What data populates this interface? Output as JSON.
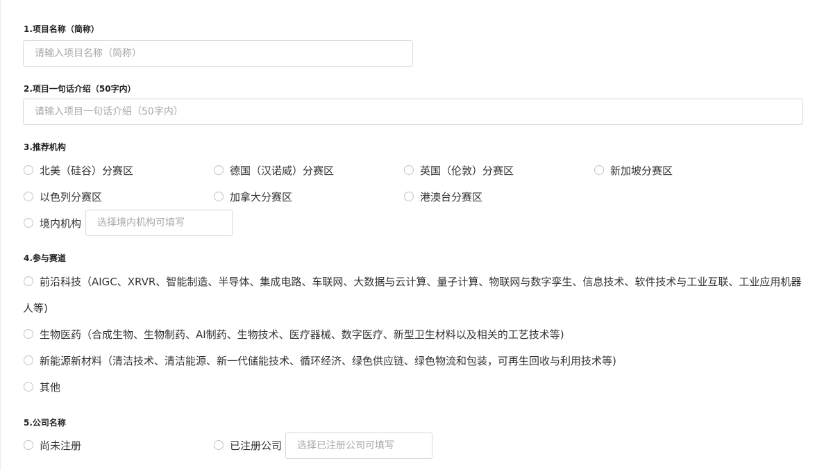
{
  "q1": {
    "label": "1.项目名称（简称）",
    "placeholder": "请输入项目名称（简称）"
  },
  "q2": {
    "label": "2.项目一句话介绍（50字内）",
    "placeholder": "请输入项目一句话介绍（50字内）"
  },
  "q3": {
    "label": "3.推荐机构",
    "options": [
      "北美（硅谷）分赛区",
      "德国（汉诺威）分赛区",
      "英国（伦敦）分赛区",
      "新加坡分赛区",
      "以色列分赛区",
      "加拿大分赛区",
      "港澳台分赛区",
      "境内机构"
    ],
    "domestic_placeholder": "选择境内机构可填写"
  },
  "q4": {
    "label": "4.参与赛道",
    "options": [
      "前沿科技（AIGC、XRVR、智能制造、半导体、集成电路、车联网、大数据与云计算、量子计算、物联网与数字孪生、信息技术、软件技术与工业互联、工业应用机器",
      "生物医药（合成生物、生物制药、AI制药、生物技术、医疗器械、数字医疗、新型卫生材料以及相关的工艺技术等)",
      "新能源新材料（清洁技术、清洁能源、新一代储能技术、循环经济、绿色供应链、绿色物流和包装，可再生回收与利用技术等)",
      "其他"
    ],
    "option1_wrap": "人等)"
  },
  "q5": {
    "label": "5.公司名称",
    "options": [
      "尚未注册",
      "已注册公司"
    ],
    "registered_placeholder": "选择已注册公司可填写"
  }
}
